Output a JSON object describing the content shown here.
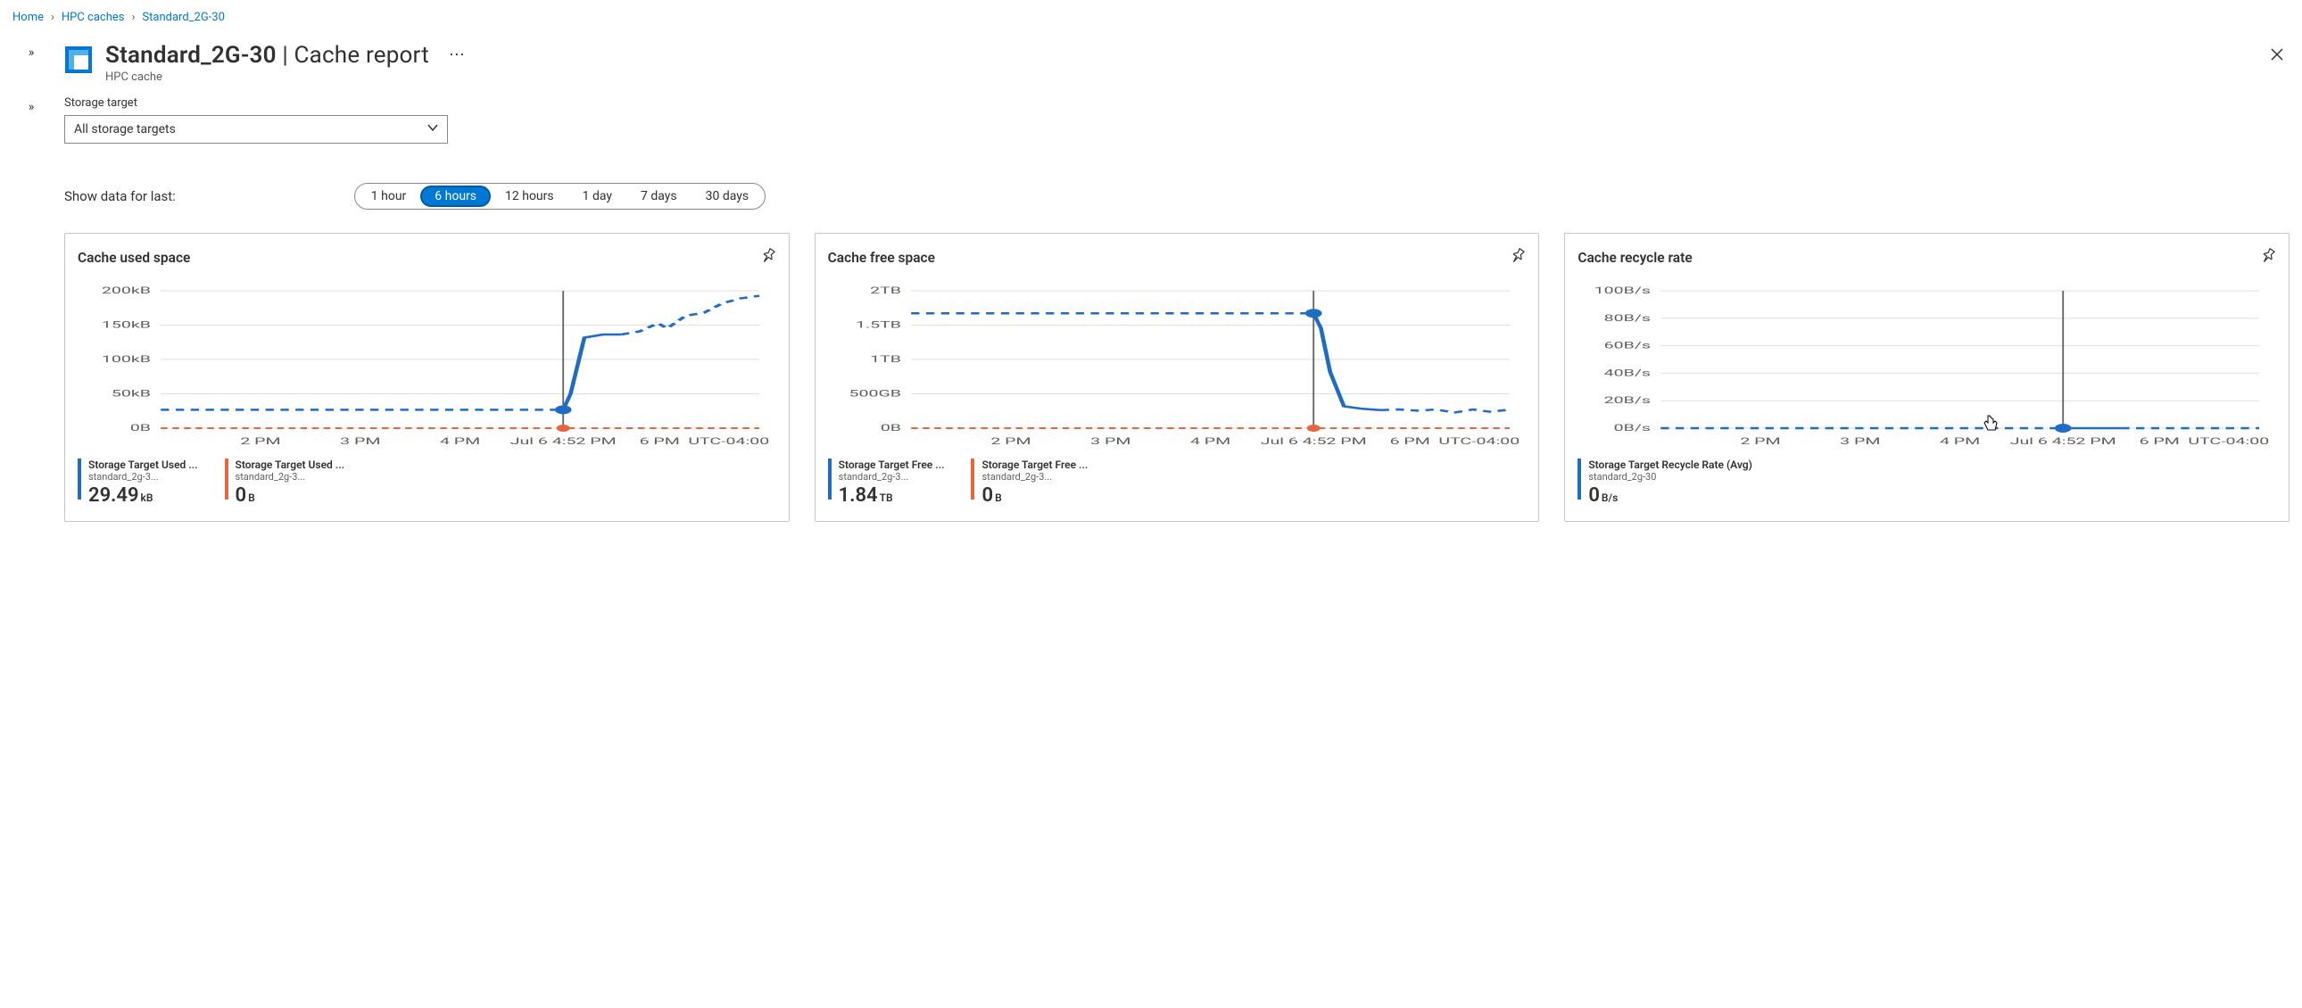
{
  "breadcrumb": {
    "home": "Home",
    "level1": "HPC caches",
    "level2": "Standard_2G-30"
  },
  "header": {
    "title_main": "Standard_2G-30",
    "title_sep": " | ",
    "title_section": "Cache report",
    "subtitle": "HPC cache"
  },
  "storage_target": {
    "label": "Storage target",
    "selected": "All storage targets"
  },
  "time_range": {
    "label": "Show data for last:",
    "options": [
      "1 hour",
      "6 hours",
      "12 hours",
      "1 day",
      "7 days",
      "30 days"
    ],
    "selected": "6 hours"
  },
  "common": {
    "x_ticks": [
      "2 PM",
      "3 PM",
      "4 PM",
      "6 PM"
    ],
    "marker_time": "Jul 6 4:52 PM",
    "tz": "UTC-04:00"
  },
  "cards": [
    {
      "title": "Cache used space",
      "y_ticks": [
        "200kB",
        "150kB",
        "100kB",
        "50kB",
        "0B"
      ],
      "legend": [
        {
          "color": "blue",
          "name": "Storage Target Used ...",
          "sub": "standard_2g-3...",
          "value": "29.49",
          "unit": "kB"
        },
        {
          "color": "orange",
          "name": "Storage Target Used ...",
          "sub": "standard_2g-3...",
          "value": "0",
          "unit": "B"
        }
      ]
    },
    {
      "title": "Cache free space",
      "y_ticks": [
        "2TB",
        "1.5TB",
        "1TB",
        "500GB",
        "0B"
      ],
      "legend": [
        {
          "color": "blue",
          "name": "Storage Target Free ...",
          "sub": "standard_2g-3...",
          "value": "1.84",
          "unit": "TB"
        },
        {
          "color": "orange",
          "name": "Storage Target Free ...",
          "sub": "standard_2g-3...",
          "value": "0",
          "unit": "B"
        }
      ]
    },
    {
      "title": "Cache recycle rate",
      "y_ticks": [
        "100B/s",
        "80B/s",
        "60B/s",
        "40B/s",
        "20B/s",
        "0B/s"
      ],
      "legend": [
        {
          "color": "blue",
          "name": "Storage Target Recycle Rate (Avg)",
          "sub": "standard_2g-30",
          "value": "0",
          "unit": "B/s"
        }
      ]
    }
  ],
  "chart_data": [
    {
      "type": "line",
      "title": "Cache used space",
      "xlabel": "",
      "ylabel": "",
      "ylim": [
        0,
        220000
      ],
      "x_tick_labels": [
        "2 PM",
        "3 PM",
        "4 PM",
        "Jul 6 4:52 PM",
        "6 PM"
      ],
      "tz": "UTC-04:00",
      "marker_x": 4.87,
      "series": [
        {
          "name": "Storage Target Used (blue)",
          "color": "#1f6cc5",
          "x": [
            0.5,
            1,
            1.5,
            2,
            2.5,
            3,
            3.5,
            4,
            4.5,
            4.87,
            4.95,
            5.1,
            5.3,
            5.5,
            5.7,
            5.9,
            6,
            6.2,
            6.4,
            6.6,
            6.8,
            7
          ],
          "values": [
            29490,
            29490,
            29490,
            29490,
            29490,
            29490,
            29490,
            29490,
            29490,
            29490,
            55000,
            145000,
            150000,
            150000,
            155000,
            168000,
            160000,
            180000,
            185000,
            200000,
            208000,
            212000
          ]
        },
        {
          "name": "Storage Target Used (orange)",
          "color": "#e7663e",
          "x": [
            0.5,
            1,
            2,
            3,
            4,
            4.87,
            5,
            5.5,
            6,
            6.5,
            7
          ],
          "values": [
            0,
            0,
            0,
            0,
            0,
            0,
            0,
            0,
            0,
            0,
            0
          ]
        }
      ]
    },
    {
      "type": "line",
      "title": "Cache free space",
      "xlabel": "",
      "ylabel": "",
      "ylim": [
        0,
        2200000000000
      ],
      "x_tick_labels": [
        "2 PM",
        "3 PM",
        "4 PM",
        "Jul 6 4:52 PM",
        "6 PM"
      ],
      "tz": "UTC-04:00",
      "marker_x": 4.87,
      "series": [
        {
          "name": "Storage Target Free (blue)",
          "color": "#1f6cc5",
          "x": [
            0.5,
            1,
            2,
            3,
            4,
            4.87,
            4.95,
            5.05,
            5.2,
            5.4,
            5.6,
            5.8,
            6,
            6.2,
            6.4,
            6.6,
            6.8,
            7
          ],
          "values": [
            1840000000000,
            1840000000000,
            1840000000000,
            1840000000000,
            1840000000000,
            1840000000000,
            1600000000000,
            900000000000,
            350000000000,
            310000000000,
            290000000000,
            300000000000,
            280000000000,
            300000000000,
            250000000000,
            300000000000,
            260000000000,
            300000000000
          ]
        },
        {
          "name": "Storage Target Free (orange)",
          "color": "#e7663e",
          "x": [
            0.5,
            1,
            2,
            3,
            4,
            4.87,
            5,
            5.5,
            6,
            6.5,
            7
          ],
          "values": [
            0,
            0,
            0,
            0,
            0,
            0,
            0,
            0,
            0,
            0,
            0
          ]
        }
      ]
    },
    {
      "type": "line",
      "title": "Cache recycle rate",
      "xlabel": "",
      "ylabel": "",
      "ylim": [
        0,
        110
      ],
      "x_tick_labels": [
        "2 PM",
        "3 PM",
        "4 PM",
        "Jul 6 4:52 PM",
        "6 PM"
      ],
      "tz": "UTC-04:00",
      "marker_x": 4.87,
      "series": [
        {
          "name": "Storage Target Recycle Rate (Avg)",
          "color": "#1f6cc5",
          "x": [
            0.5,
            1,
            2,
            3,
            4,
            4.87,
            5,
            5.5,
            6,
            6.5,
            7
          ],
          "values": [
            0,
            0,
            0,
            0,
            0,
            0,
            0,
            0,
            0,
            0,
            0
          ]
        }
      ]
    }
  ]
}
